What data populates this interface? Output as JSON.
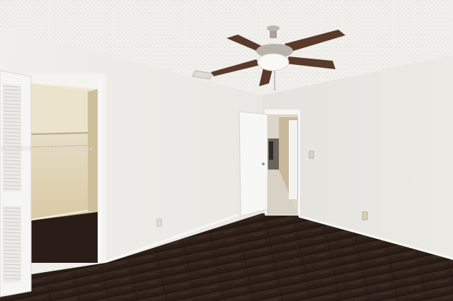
{
  "photo": {
    "watermark": "A1176658 © Miami MLS Media"
  },
  "colors": {
    "ceiling": "#f1f0ec",
    "left_wall": "#eeede9",
    "right_wall": "#e6e5e0",
    "closet_interior": "#e3d8be",
    "floor": "#2e201a",
    "baseboard": "#f6f6f4",
    "fan_blade": "#5a3a2a",
    "fan_metal": "#b9b4aa"
  },
  "icons": {
    "fan": "ceiling-fan-icon",
    "vent": "air-vent-icon",
    "outlet": "power-outlet-icon",
    "switch": "light-switch-icon"
  }
}
